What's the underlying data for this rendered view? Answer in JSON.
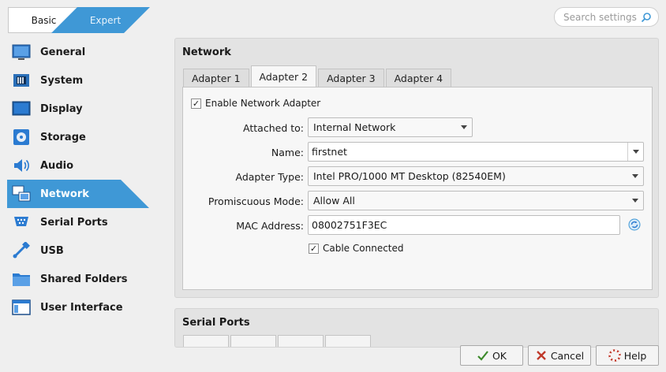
{
  "mode": {
    "basic": "Basic",
    "expert": "Expert"
  },
  "search": {
    "placeholder": "Search settings"
  },
  "sidebar": {
    "items": [
      {
        "label": "General",
        "icon": "general-icon"
      },
      {
        "label": "System",
        "icon": "system-icon"
      },
      {
        "label": "Display",
        "icon": "display-icon"
      },
      {
        "label": "Storage",
        "icon": "storage-icon"
      },
      {
        "label": "Audio",
        "icon": "audio-icon"
      },
      {
        "label": "Network",
        "icon": "network-icon",
        "active": true
      },
      {
        "label": "Serial Ports",
        "icon": "serial-ports-icon"
      },
      {
        "label": "USB",
        "icon": "usb-icon"
      },
      {
        "label": "Shared Folders",
        "icon": "shared-folders-icon"
      },
      {
        "label": "User Interface",
        "icon": "user-interface-icon"
      }
    ]
  },
  "network": {
    "title": "Network",
    "tabs": [
      "Adapter 1",
      "Adapter 2",
      "Adapter 3",
      "Adapter 4"
    ],
    "active_tab": "Adapter 2",
    "enable_label": "Enable Network Adapter",
    "enabled": true,
    "attached_label": "Attached to:",
    "attached_value": "Internal Network",
    "name_label": "Name:",
    "name_value": "firstnet",
    "adapter_type_label": "Adapter Type:",
    "adapter_type_value": "Intel PRO/1000 MT Desktop (82540EM)",
    "promiscuous_label": "Promiscuous Mode:",
    "promiscuous_value": "Allow All",
    "mac_label": "MAC Address:",
    "mac_value": "08002751F3EC",
    "cable_label": "Cable Connected",
    "cable_connected": true
  },
  "serial": {
    "title": "Serial Ports"
  },
  "buttons": {
    "ok": "OK",
    "cancel": "Cancel",
    "help": "Help"
  },
  "colors": {
    "accent": "#3f98d6"
  }
}
